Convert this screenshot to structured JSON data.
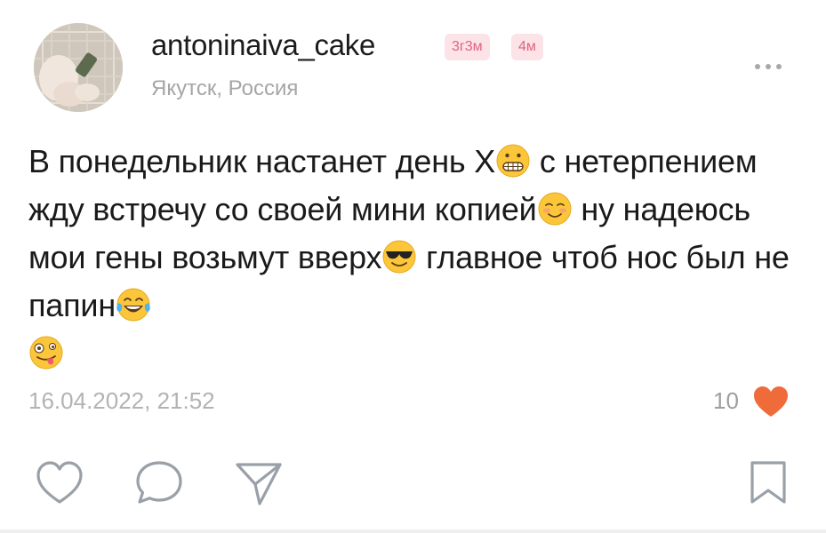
{
  "header": {
    "username": "antoninaiva_cake",
    "badges": [
      "3г3м",
      "4м"
    ],
    "location": "Якутск, Россия"
  },
  "post": {
    "segments": [
      "В понедельник настанет день Х",
      " с нетерпением жду встречу со своей мини копией",
      " ну надеюсь мои гены возьмут вверх",
      " главное чтоб нос был не папин"
    ],
    "emojis": [
      "grimacing-face",
      "smiling-face-blushing",
      "smiling-face-with-sunglasses",
      "face-with-tears-of-joy",
      "zany-face"
    ]
  },
  "meta": {
    "timestamp": "16.04.2022, 21:52",
    "like_count": "10"
  },
  "actions": {
    "like_icon": "heart-outline-icon",
    "comment_icon": "comment-bubble-icon",
    "share_icon": "send-icon",
    "bookmark_icon": "bookmark-icon"
  },
  "colors": {
    "accent_heart": "#f06b3a",
    "badge_bg": "#fbe3e8",
    "badge_text": "#e1647c",
    "muted_text": "#a6a6a6"
  }
}
